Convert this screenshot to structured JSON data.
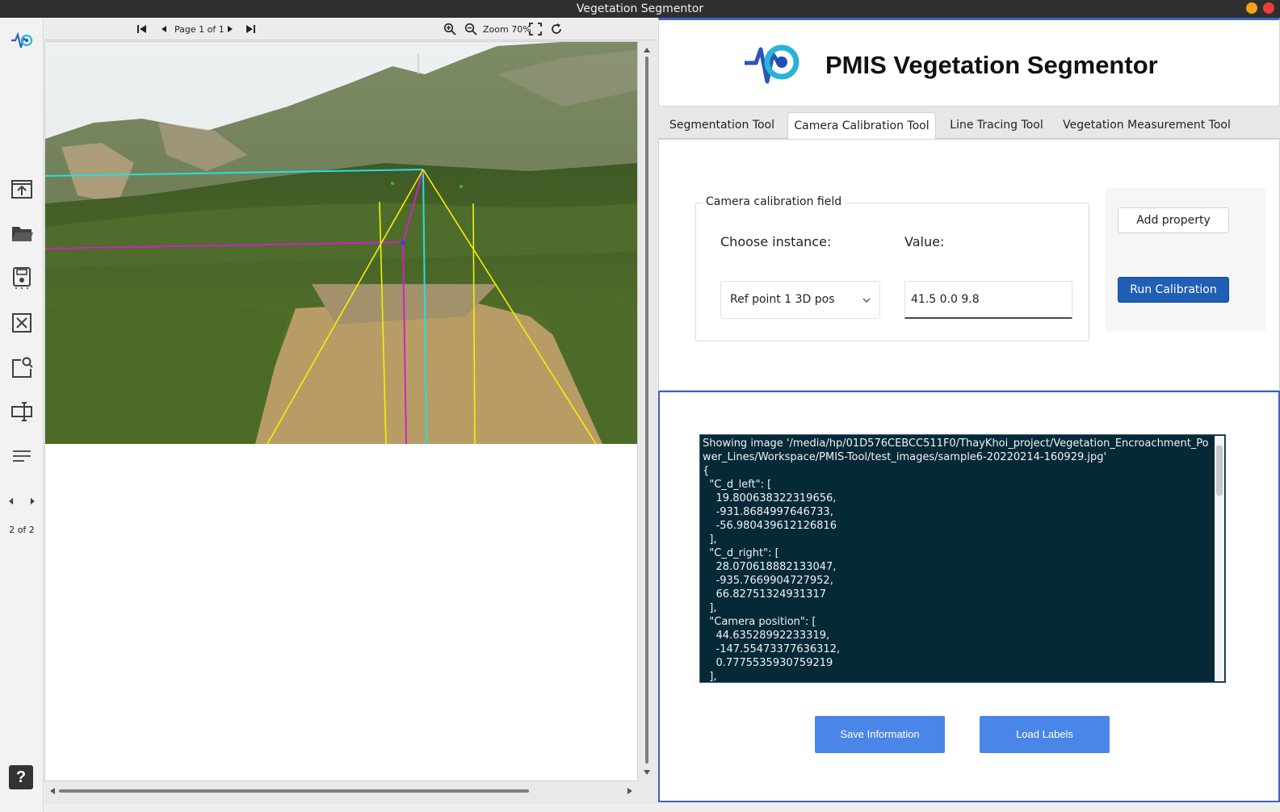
{
  "window": {
    "title": "Vegetation Segmentor"
  },
  "sidebar": {
    "page_indicator": "2 of 2"
  },
  "viewer": {
    "page_label": "Page 1 of 1",
    "zoom_label": "Zoom 70%"
  },
  "header": {
    "title": "PMIS Vegetation Segmentor"
  },
  "tabs": [
    {
      "label": "Segmentation Tool"
    },
    {
      "label": "Camera Calibration Tool"
    },
    {
      "label": "Line Tracing Tool"
    },
    {
      "label": "Vegetation Measurement Tool"
    }
  ],
  "calibration": {
    "group_title": "Camera calibration field",
    "instance_label": "Choose instance:",
    "value_label": "Value:",
    "selected_instance": "Ref point 1 3D pos",
    "value": "41.5 0.0 9.8",
    "add_property": "Add property",
    "run_calibration": "Run Calibration"
  },
  "console": {
    "text": "Showing image '/media/hp/01D576CEBCC511F0/ThayKhoi_project/Vegetation_Encroachment_Power_Lines/Workspace/PMIS-Tool/test_images/sample6-20220214-160929.jpg'\n{\n  \"C_d_left\": [\n    19.800638322319656,\n    -931.8684997646733,\n    -56.980439612126816\n  ],\n  \"C_d_right\": [\n    28.070618882133047,\n    -935.7669904727952,\n    66.82751324931317\n  ],\n  \"Camera position\": [\n    44.63528992233319,\n    -147.55473377636312,\n    0.7775535930759219\n  ],"
  },
  "actions": {
    "save_information": "Save Information",
    "load_labels": "Load Labels"
  },
  "colors": {
    "accent": "#3d63c9",
    "run_button": "#1f5fb5",
    "action_button": "#4a86e8",
    "console_bg": "#062938",
    "line_cyan": "#22e0e0",
    "line_magenta": "#d020c8",
    "line_yellow": "#f5f000"
  }
}
